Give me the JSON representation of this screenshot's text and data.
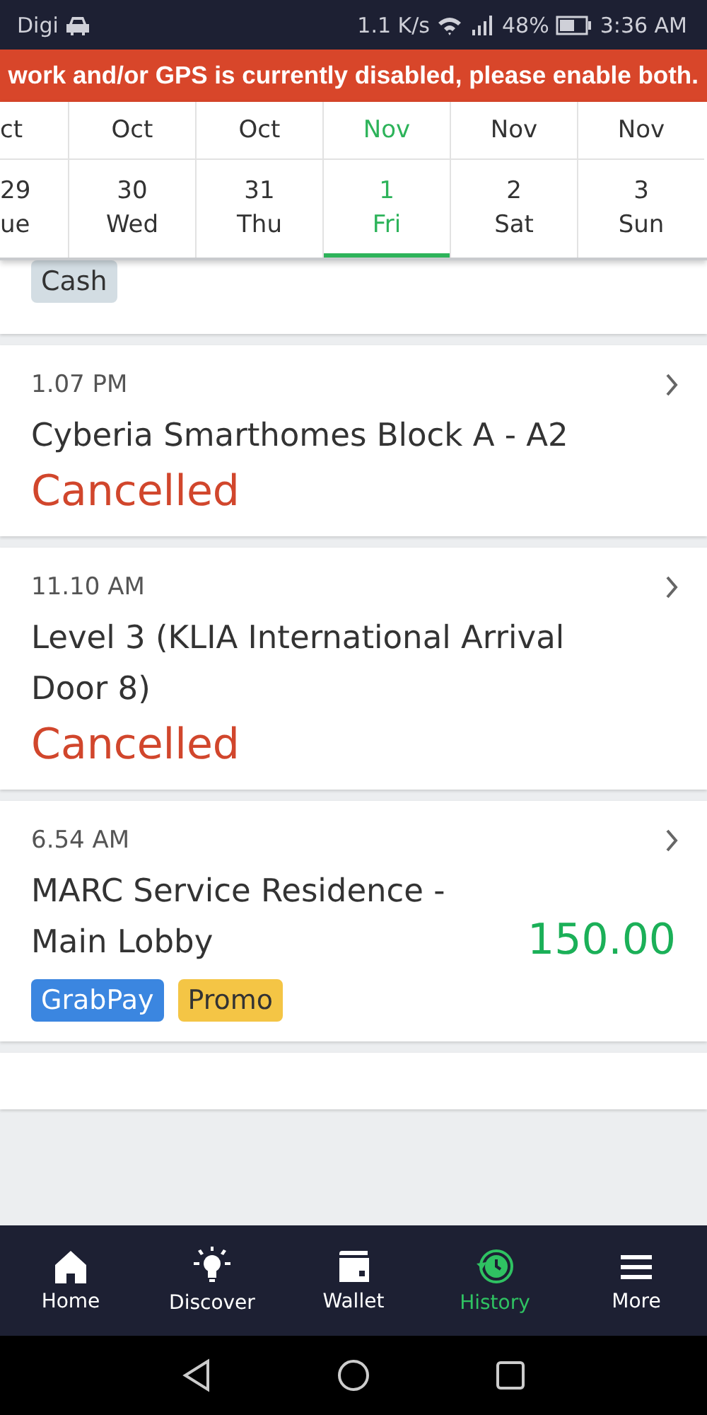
{
  "status_bar": {
    "carrier": "Digi",
    "speed": "1.1 K/s",
    "battery": "48%",
    "time": "3:36 AM"
  },
  "banner": {
    "text": "work and/or GPS is currently disabled, please enable both."
  },
  "dates": [
    {
      "month": "ct",
      "day": "29",
      "weekday": "ue",
      "selected": false
    },
    {
      "month": "Oct",
      "day": "30",
      "weekday": "Wed",
      "selected": false
    },
    {
      "month": "Oct",
      "day": "31",
      "weekday": "Thu",
      "selected": false
    },
    {
      "month": "Nov",
      "day": "1",
      "weekday": "Fri",
      "selected": true
    },
    {
      "month": "Nov",
      "day": "2",
      "weekday": "Sat",
      "selected": false
    },
    {
      "month": "Nov",
      "day": "3",
      "weekday": "Sun",
      "selected": false
    }
  ],
  "trips": [
    {
      "kind": "partial",
      "tags": [
        {
          "label": "Cash",
          "color": "#d3dde3"
        }
      ]
    },
    {
      "kind": "full",
      "time": "1.07 PM",
      "place": "Cyberia Smarthomes Block A - A2",
      "status": "Cancelled"
    },
    {
      "kind": "full",
      "time": "11.10 AM",
      "place": "Level 3 (KLIA International Arrival Door 8)",
      "status": "Cancelled"
    },
    {
      "kind": "full",
      "time": "6.54 AM",
      "place": "MARC Service Residence - Main Lobby",
      "amount": "150.00",
      "tags": [
        {
          "label": "GrabPay",
          "color": "#3b86e0"
        },
        {
          "label": "Promo",
          "color": "#f4c545"
        }
      ]
    }
  ],
  "nav": [
    {
      "label": "Home",
      "selected": false
    },
    {
      "label": "Discover",
      "selected": false
    },
    {
      "label": "Wallet",
      "selected": false
    },
    {
      "label": "History",
      "selected": true
    },
    {
      "label": "More",
      "selected": false
    }
  ]
}
